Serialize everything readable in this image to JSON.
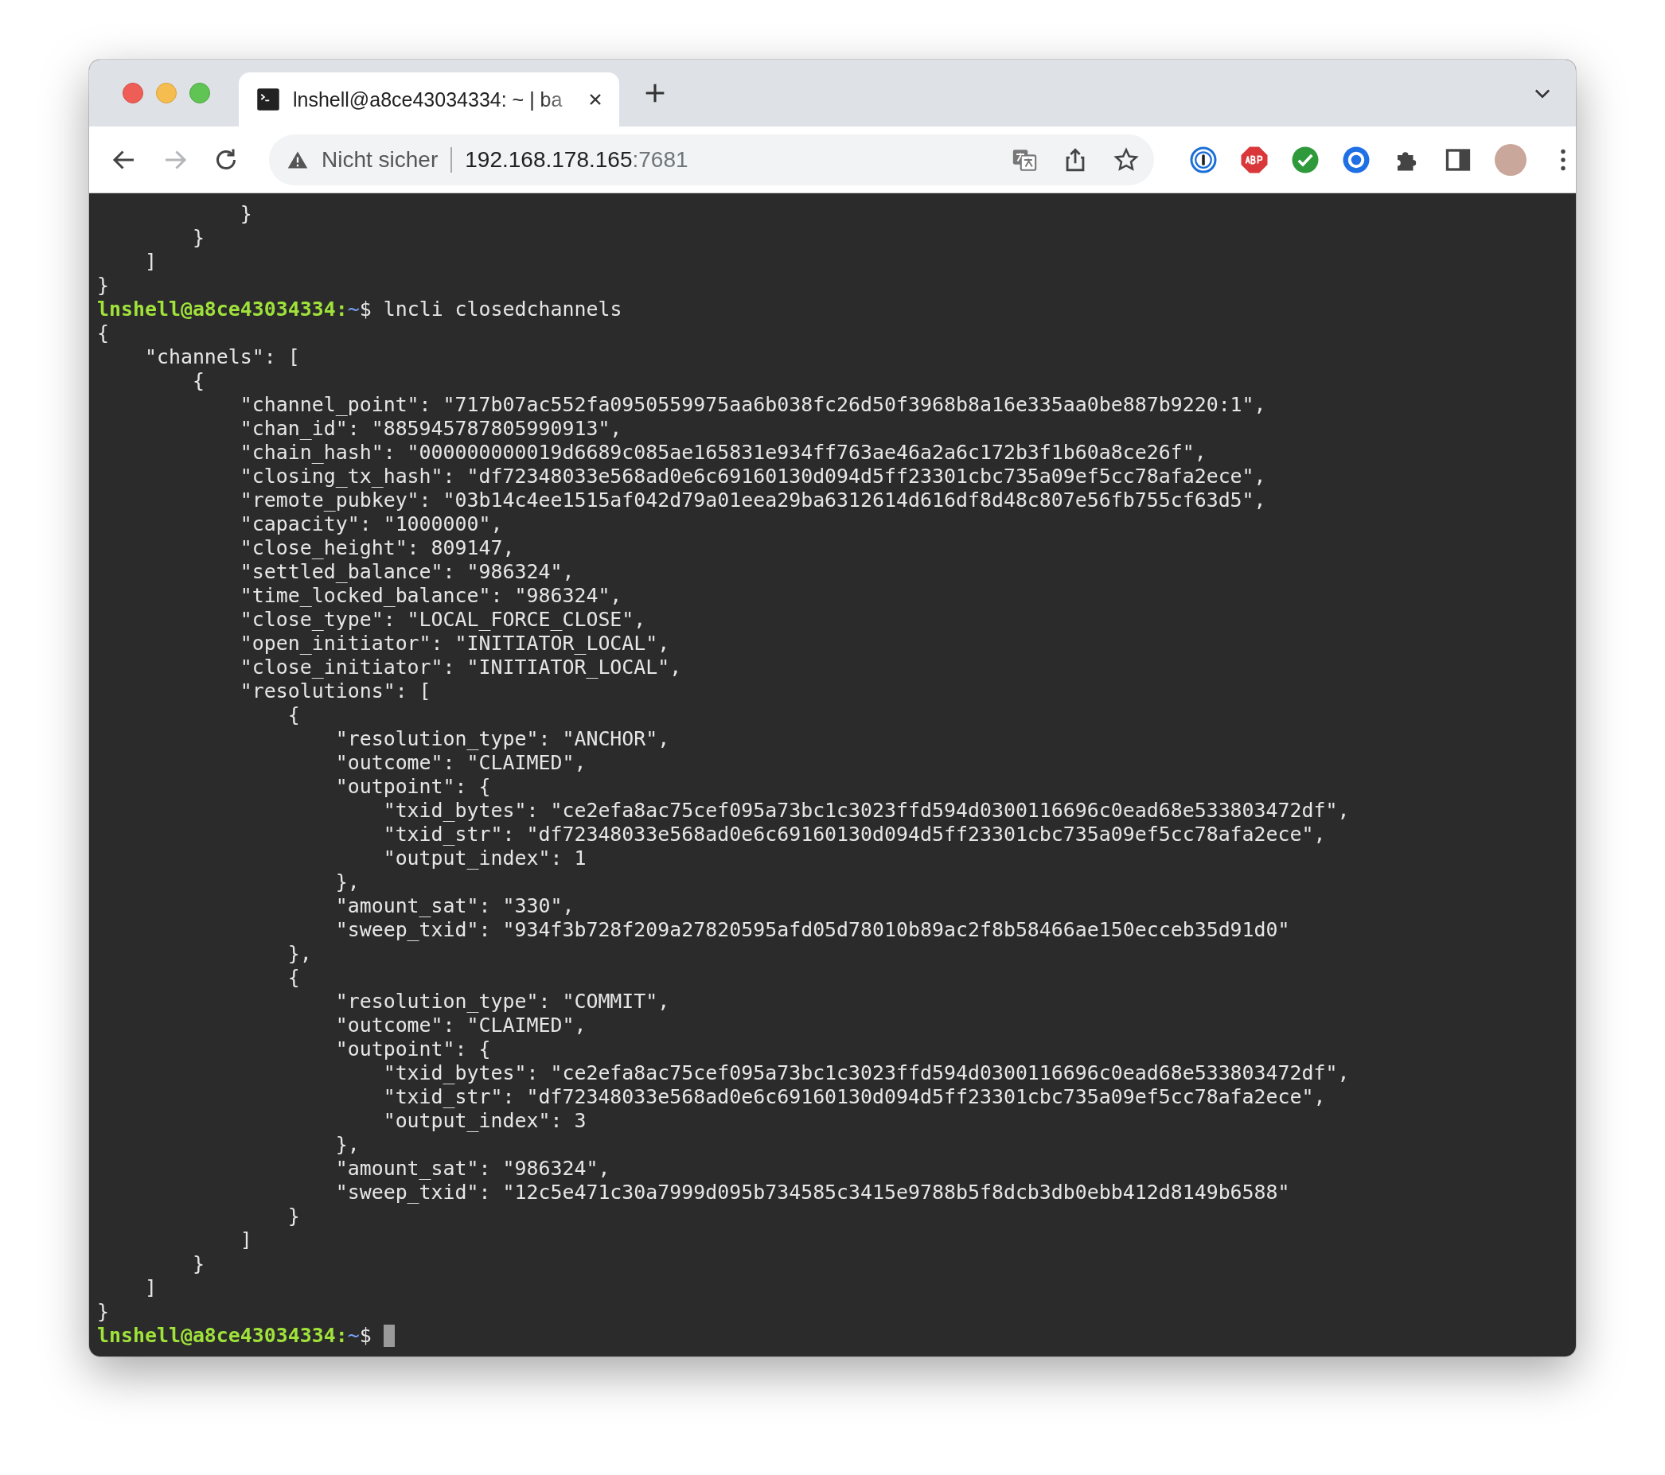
{
  "tabs": [
    {
      "title": "lnshell@a8ce43034334: ~ | ba",
      "selected": true
    }
  ],
  "toolbar": {
    "forward_disabled": true,
    "security": "Nicht sicher",
    "url_host": "192.168.178.165",
    "url_port": ":7681"
  },
  "terminal": {
    "lines": [
      {
        "kind": "output",
        "text": "            }"
      },
      {
        "kind": "output",
        "text": "        }"
      },
      {
        "kind": "output",
        "text": "    ]"
      },
      {
        "kind": "output",
        "text": "}"
      },
      {
        "kind": "prompt",
        "user": "lnshell@a8ce43034334:",
        "path": "~",
        "symbol": "$",
        "command": "lncli closedchannels",
        "cursor": false
      },
      {
        "kind": "output",
        "text": "{"
      },
      {
        "kind": "output",
        "text": "    \"channels\": ["
      },
      {
        "kind": "output",
        "text": "        {"
      },
      {
        "kind": "output",
        "text": "            \"channel_point\": \"717b07ac552fa0950559975aa6b038fc26d50f3968b8a16e335aa0be887b9220:1\","
      },
      {
        "kind": "output",
        "text": "            \"chan_id\": \"885945787805990913\","
      },
      {
        "kind": "output",
        "text": "            \"chain_hash\": \"000000000019d6689c085ae165831e934ff763ae46a2a6c172b3f1b60a8ce26f\","
      },
      {
        "kind": "output",
        "text": "            \"closing_tx_hash\": \"df72348033e568ad0e6c69160130d094d5ff23301cbc735a09ef5cc78afa2ece\","
      },
      {
        "kind": "output",
        "text": "            \"remote_pubkey\": \"03b14c4ee1515af042d79a01eea29ba6312614d616df8d48c807e56fb755cf63d5\","
      },
      {
        "kind": "output",
        "text": "            \"capacity\": \"1000000\","
      },
      {
        "kind": "output",
        "text": "            \"close_height\": 809147,"
      },
      {
        "kind": "output",
        "text": "            \"settled_balance\": \"986324\","
      },
      {
        "kind": "output",
        "text": "            \"time_locked_balance\": \"986324\","
      },
      {
        "kind": "output",
        "text": "            \"close_type\": \"LOCAL_FORCE_CLOSE\","
      },
      {
        "kind": "output",
        "text": "            \"open_initiator\": \"INITIATOR_LOCAL\","
      },
      {
        "kind": "output",
        "text": "            \"close_initiator\": \"INITIATOR_LOCAL\","
      },
      {
        "kind": "output",
        "text": "            \"resolutions\": ["
      },
      {
        "kind": "output",
        "text": "                {"
      },
      {
        "kind": "output",
        "text": "                    \"resolution_type\": \"ANCHOR\","
      },
      {
        "kind": "output",
        "text": "                    \"outcome\": \"CLAIMED\","
      },
      {
        "kind": "output",
        "text": "                    \"outpoint\": {"
      },
      {
        "kind": "output",
        "text": "                        \"txid_bytes\": \"ce2efa8ac75cef095a73bc1c3023ffd594d0300116696c0ead68e533803472df\","
      },
      {
        "kind": "output",
        "text": "                        \"txid_str\": \"df72348033e568ad0e6c69160130d094d5ff23301cbc735a09ef5cc78afa2ece\","
      },
      {
        "kind": "output",
        "text": "                        \"output_index\": 1"
      },
      {
        "kind": "output",
        "text": "                    },"
      },
      {
        "kind": "output",
        "text": "                    \"amount_sat\": \"330\","
      },
      {
        "kind": "output",
        "text": "                    \"sweep_txid\": \"934f3b728f209a27820595afd05d78010b89ac2f8b58466ae150ecceb35d91d0\""
      },
      {
        "kind": "output",
        "text": "                },"
      },
      {
        "kind": "output",
        "text": "                {"
      },
      {
        "kind": "output",
        "text": "                    \"resolution_type\": \"COMMIT\","
      },
      {
        "kind": "output",
        "text": "                    \"outcome\": \"CLAIMED\","
      },
      {
        "kind": "output",
        "text": "                    \"outpoint\": {"
      },
      {
        "kind": "output",
        "text": "                        \"txid_bytes\": \"ce2efa8ac75cef095a73bc1c3023ffd594d0300116696c0ead68e533803472df\","
      },
      {
        "kind": "output",
        "text": "                        \"txid_str\": \"df72348033e568ad0e6c69160130d094d5ff23301cbc735a09ef5cc78afa2ece\","
      },
      {
        "kind": "output",
        "text": "                        \"output_index\": 3"
      },
      {
        "kind": "output",
        "text": "                    },"
      },
      {
        "kind": "output",
        "text": "                    \"amount_sat\": \"986324\","
      },
      {
        "kind": "output",
        "text": "                    \"sweep_txid\": \"12c5e471c30a7999d095b734585c3415e9788b5f8dcb3db0ebb412d8149b6588\""
      },
      {
        "kind": "output",
        "text": "                }"
      },
      {
        "kind": "output",
        "text": "            ]"
      },
      {
        "kind": "output",
        "text": "        }"
      },
      {
        "kind": "output",
        "text": "    ]"
      },
      {
        "kind": "output",
        "text": "}"
      },
      {
        "kind": "prompt",
        "user": "lnshell@a8ce43034334:",
        "path": "~",
        "symbol": "$",
        "cursor": true
      }
    ]
  }
}
